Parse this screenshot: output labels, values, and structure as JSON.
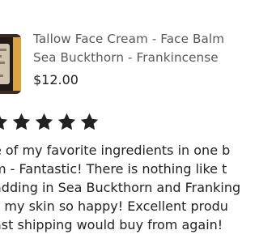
{
  "product": {
    "title_lines": [
      "Tallow Face Cream - Face Balm",
      "Sea Buckthorn - Frankincense"
    ],
    "price": "$12.00",
    "thumbnail_icon": "product-jar-icon"
  },
  "review": {
    "rating": 5,
    "rating_max": 5,
    "star_icon": "star-icon",
    "star_color": "#222222",
    "text_lines": [
      "e of my favorite ingredients in one b",
      "m - Fantastic!  There is nothing like t",
      "adding in Sea Buckthorn and Franking",
      "s my skin so happy!  Excellent produ",
      "ast shipping would buy from again!"
    ]
  },
  "colors": {
    "title": "#595959",
    "text": "#222222",
    "jar_lid": "#d9a441"
  }
}
